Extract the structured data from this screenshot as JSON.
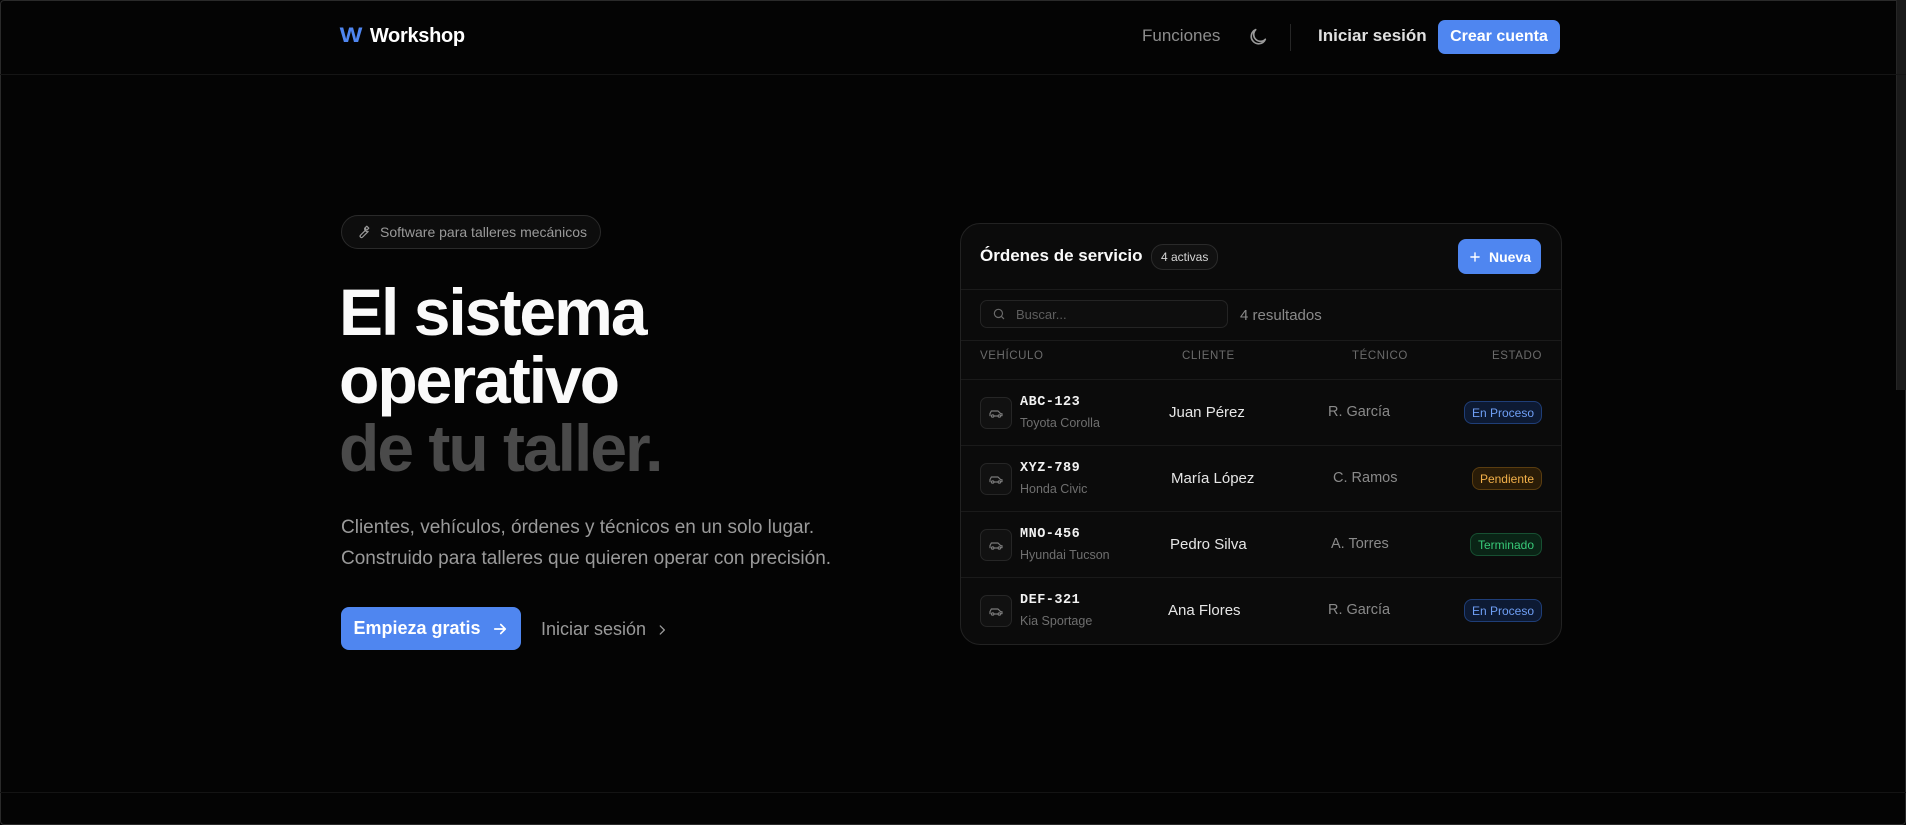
{
  "header": {
    "brand_logo": "W",
    "brand_name": "Workshop",
    "nav_features": "Funciones",
    "login": "Iniciar sesión",
    "signup": "Crear cuenta"
  },
  "hero": {
    "pill_label": "Software para talleres mecánicos",
    "title_line1": "El sistema",
    "title_line2": "operativo",
    "title_line3": "de tu taller.",
    "lead_line1": "Clientes, vehículos, órdenes y técnicos en un solo lugar.",
    "lead_line2": "Construido para talleres que quieren operar con precisión.",
    "cta_primary": "Empieza gratis",
    "cta_secondary": "Iniciar sesión"
  },
  "card": {
    "title": "Órdenes de servicio",
    "active_badge": "4 activas",
    "new_button": "Nueva",
    "search_placeholder": "Buscar...",
    "result_count": "4 resultados",
    "columns": {
      "vehicle": "VEHÍCULO",
      "client": "CLIENTE",
      "technician": "TÉCNICO",
      "status": "ESTADO"
    },
    "rows": [
      {
        "plate": "ABC-123",
        "model": "Toyota Corolla",
        "client": "Juan Pérez",
        "technician": "R. García",
        "status": "En Proceso"
      },
      {
        "plate": "XYZ-789",
        "model": "Honda Civic",
        "client": "María López",
        "technician": "C. Ramos",
        "status": "Pendiente"
      },
      {
        "plate": "MNO-456",
        "model": "Hyundai Tucson",
        "client": "Pedro Silva",
        "technician": "A. Torres",
        "status": "Terminado"
      },
      {
        "plate": "DEF-321",
        "model": "Kia Sportage",
        "client": "Ana Flores",
        "technician": "R. García",
        "status": "En Proceso"
      }
    ]
  },
  "colors": {
    "accent": "#4f86f0",
    "background": "#040404",
    "status_in_progress": "#6f9ff5",
    "status_pending": "#f3b14a",
    "status_done": "#38c978"
  },
  "icons": {
    "logo": "w-logo-icon",
    "theme": "moon-icon",
    "pill": "wrench-icon",
    "cta": "arrow-right-icon",
    "secondary": "chevron-right-icon",
    "new": "plus-icon",
    "search": "search-icon",
    "vehicle": "car-icon"
  }
}
